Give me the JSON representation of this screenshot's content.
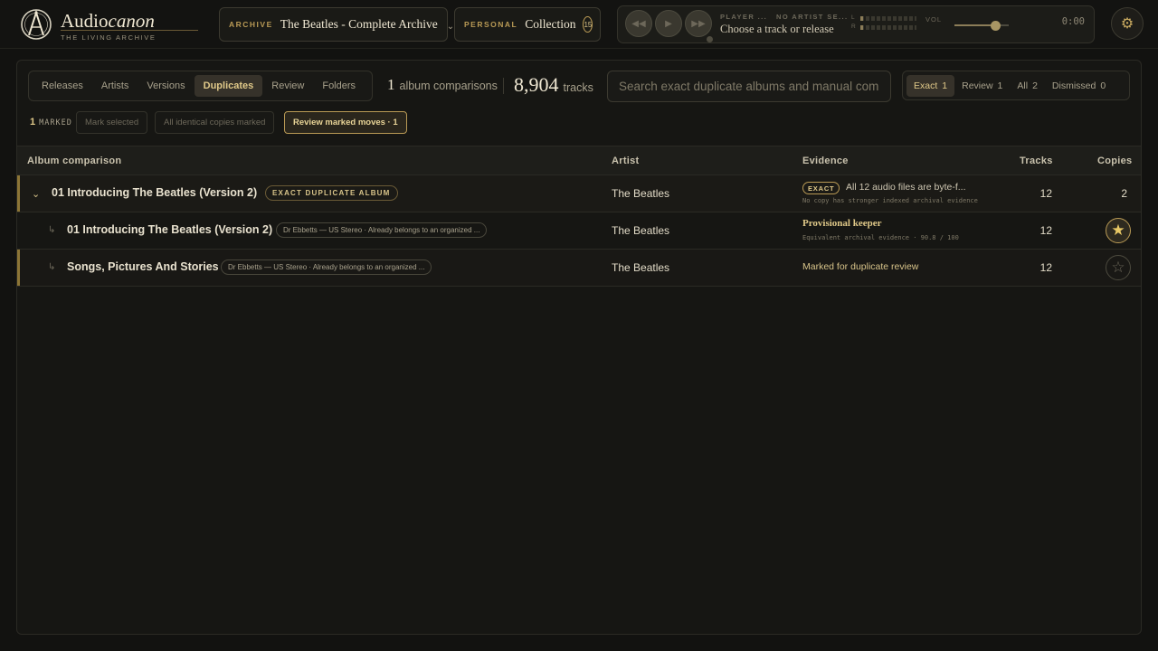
{
  "app": {
    "name_plain": "Audio",
    "name_italic": "canon",
    "tagline": "THE LIVING ARCHIVE"
  },
  "archive": {
    "kicker": "ARCHIVE",
    "value": "The Beatles - Complete Archive",
    "chevron": "⌄"
  },
  "personal": {
    "kicker": "PERSONAL",
    "value": "Collection",
    "count": "15"
  },
  "player": {
    "rewind": "◀◀",
    "play": "▶",
    "forward": "▶▶",
    "kicker1": "PLAYER ...",
    "kicker2": "NO ARTIST SE...",
    "track": "Choose a track or release",
    "left_label": "L",
    "right_label": "R",
    "vol_label": "VOL",
    "volume": 0.75,
    "time": "0:00"
  },
  "settings_icon": "⚙",
  "tabs": [
    {
      "label": "Releases",
      "active": false
    },
    {
      "label": "Artists",
      "active": false
    },
    {
      "label": "Versions",
      "active": false
    },
    {
      "label": "Duplicates",
      "active": true
    },
    {
      "label": "Review",
      "active": false
    },
    {
      "label": "Folders",
      "active": false
    }
  ],
  "stats": {
    "comparisons_num": "1",
    "comparisons_label": "album comparisons",
    "tracks_num": "8,904",
    "tracks_label": "tracks"
  },
  "search": {
    "placeholder": "Search exact duplicate albums and manual comparisons"
  },
  "filters": [
    {
      "label": "Exact",
      "count": "1",
      "active": true
    },
    {
      "label": "Review",
      "count": "1",
      "active": false
    },
    {
      "label": "All",
      "count": "2",
      "active": false
    },
    {
      "label": "Dismissed",
      "count": "0",
      "active": false
    }
  ],
  "actions": {
    "marked_num": "1",
    "marked_label": "MARKED",
    "mark_selected": "Mark selected",
    "all_identical": "All identical copies marked",
    "review_moves": "Review marked moves · 1"
  },
  "table": {
    "headers": {
      "album": "Album comparison",
      "artist": "Artist",
      "evidence": "Evidence",
      "tracks": "Tracks",
      "copies": "Copies"
    },
    "group": {
      "chevron": "⌄",
      "title": "01 Introducing The Beatles (Version 2)",
      "badge": "EXACT DUPLICATE ALBUM",
      "artist": "The Beatles",
      "evidence_badge": "EXACT",
      "evidence_text": "All 12 audio files are byte-f...",
      "evidence_sub": "No copy has stronger indexed archival evidence",
      "tracks": "12",
      "copies": "2"
    },
    "rows": [
      {
        "arrow": "↳",
        "title": "01 Introducing The Beatles (Version 2)",
        "note": "Dr Ebbetts — US Stereo · Already belongs to an organized ...",
        "artist": "The Beatles",
        "evidence_title": "Provisional keeper",
        "evidence_sub": "Equivalent archival evidence · 90.8 / 100",
        "tracks": "12",
        "star": "★"
      },
      {
        "arrow": "↳",
        "title": "Songs, Pictures And Stories",
        "note": "Dr Ebbetts — US Stereo · Already belongs to an organized ...",
        "artist": "The Beatles",
        "evidence_text": "Marked for duplicate review",
        "tracks": "12",
        "star": "☆"
      }
    ]
  }
}
